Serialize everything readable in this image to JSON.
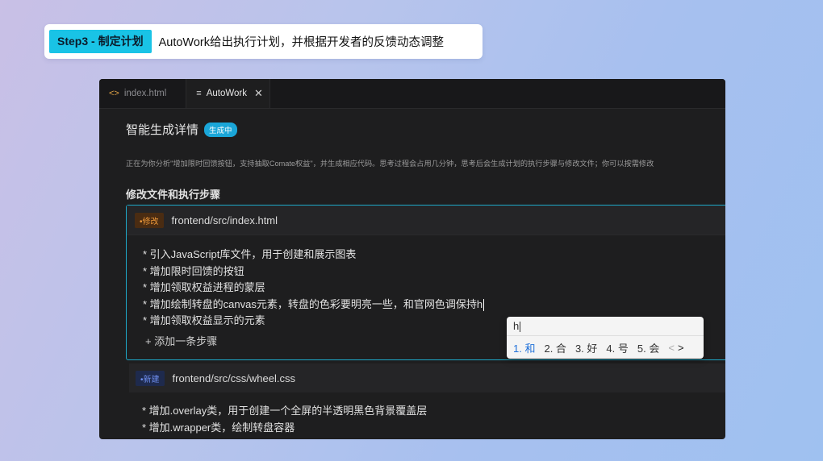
{
  "banner": {
    "step_label": "Step3 - 制定计划",
    "text": "AutoWork给出执行计划，并根据开发者的反馈动态调整"
  },
  "tabs": [
    {
      "label": "index.html",
      "icon": "code-icon"
    },
    {
      "label": "AutoWork",
      "icon": "document-icon"
    }
  ],
  "page": {
    "title": "智能生成详情",
    "status_badge": "生成中",
    "description": "正在为你分析\"增加限时回馈按钮，支持抽取Comate权益\"，并生成相应代码。思考过程会占用几分钟，思考后会生成计划的执行步骤与修改文件；你可以按需修改",
    "section_title": "修改文件和执行步骤"
  },
  "files": [
    {
      "tag": "•修改",
      "path": "frontend/src/index.html",
      "steps": [
        "* 引入JavaScript库文件，用于创建和展示图表",
        "* 增加限时回馈的按钮",
        "* 增加领取权益进程的蒙层",
        "* 增加绘制转盘的canvas元素，转盘的色彩要明亮一些，和官网色调保持h",
        "* 增加领取权益显示的元素"
      ],
      "add_step": "+ 添加一条步骤"
    },
    {
      "tag": "•新建",
      "path": "frontend/src/css/wheel.css",
      "steps": [
        "* 增加.overlay类，用于创建一个全屏的半透明黑色背景覆盖层",
        "* 增加.wrapper类，绘制转盘容器"
      ]
    }
  ],
  "ime": {
    "input": "h",
    "candidates": [
      "1. 和",
      "2. 合",
      "3. 好",
      "4. 号",
      "5. 会"
    ],
    "prev": "<",
    "next": ">"
  },
  "colors": {
    "accent": "#19c3e6",
    "card_border": "#1ea9c9",
    "modify_tag": "#f09a3a",
    "new_tag": "#6f8ff0",
    "ime_selected": "#1e6fd9"
  }
}
